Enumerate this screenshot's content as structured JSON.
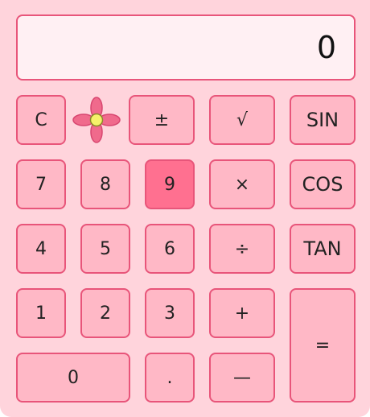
{
  "display": {
    "value": "0"
  },
  "buttons": {
    "clear": "C",
    "plus_minus": "±",
    "sqrt": "√",
    "sin": "SIN",
    "seven": "7",
    "eight": "8",
    "nine": "9",
    "multiply": "×",
    "cos": "COS",
    "four": "4",
    "five": "5",
    "six": "6",
    "divide": "÷",
    "tan": "TAN",
    "one": "1",
    "two": "2",
    "three": "3",
    "plus": "+",
    "equals": "=",
    "zero": "0",
    "dot": ".",
    "minus": "—"
  },
  "colors": {
    "background": "#ffd4dc",
    "button": "#ffb8c6",
    "button_active": "#ff7090",
    "border": "#e8557a",
    "display": "#fff0f3"
  },
  "icons": {
    "decoration": "flower-icon"
  }
}
